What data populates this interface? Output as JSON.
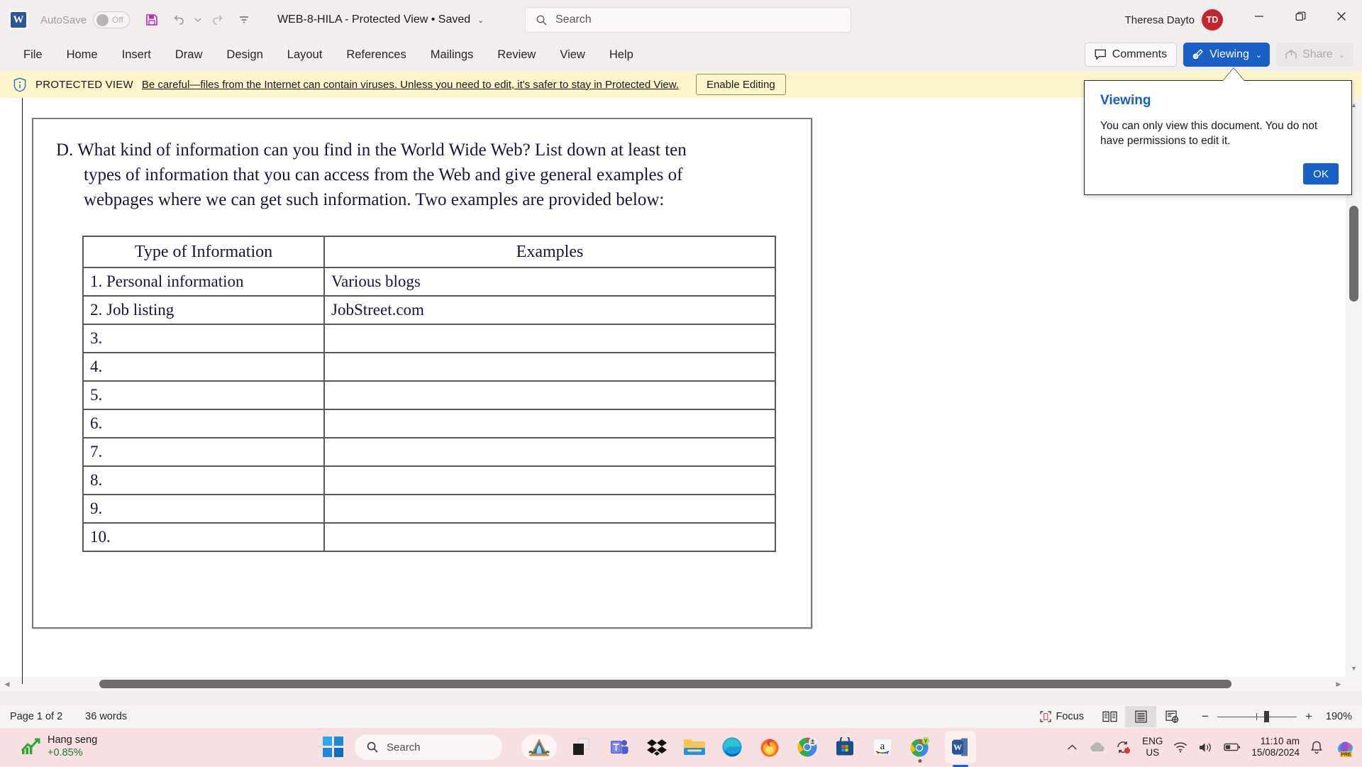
{
  "titlebar": {
    "app_logo": "word-logo",
    "autosave_label": "AutoSave",
    "autosave_state": "Off",
    "save_icon": "save-icon",
    "undo_icon": "undo-icon",
    "redo_icon": "redo-icon",
    "customize_icon": "customize-quick-access-icon",
    "document_title": "WEB-8-HILA  -  Protected View • Saved",
    "title_chevron": "⌄",
    "search_placeholder": "Search",
    "search_icon": "search-icon",
    "user_name": "Theresa Dayto",
    "user_initials": "TD",
    "minimize": "minimize-icon",
    "restore": "restore-icon",
    "close": "close-icon"
  },
  "ribbon": {
    "tabs": [
      {
        "label": "File"
      },
      {
        "label": "Home"
      },
      {
        "label": "Insert"
      },
      {
        "label": "Draw"
      },
      {
        "label": "Design"
      },
      {
        "label": "Layout"
      },
      {
        "label": "References"
      },
      {
        "label": "Mailings"
      },
      {
        "label": "Review"
      },
      {
        "label": "View"
      },
      {
        "label": "Help"
      }
    ],
    "comments_label": "Comments",
    "comments_icon": "comment-icon",
    "viewing_label": "Viewing",
    "viewing_icon": "pen-disabled-icon",
    "viewing_chevron": "⌄",
    "share_label": "Share",
    "share_icon": "share-icon",
    "share_chevron": "⌄",
    "accent_color": "#1a5fc4"
  },
  "protected_view": {
    "icon": "shield-info-icon",
    "label": "PROTECTED VIEW",
    "message": "Be careful—files from the Internet can contain viruses. Unless you need to edit, it's safer to stay in Protected View.",
    "button_label": "Enable Editing",
    "background_color": "#fdf6cd"
  },
  "callout": {
    "title": "Viewing",
    "body": "You can only view this document. You do not have permissions to edit it.",
    "ok_label": "OK",
    "title_color": "#1a5fc4"
  },
  "document": {
    "paragraph_line1": "D. What kind of information can you find in the World Wide Web? List down at least ten",
    "paragraph_line2": "types of information that you can access from the Web and give general examples of",
    "paragraph_line3": "webpages where we can get such information. Two examples are provided below:",
    "table": {
      "headers": [
        "Type of Information",
        "Examples"
      ],
      "rows": [
        [
          "1. Personal information",
          "Various blogs"
        ],
        [
          "2. Job listing",
          "JobStreet.com"
        ],
        [
          "3.",
          ""
        ],
        [
          "4.",
          ""
        ],
        [
          "5.",
          ""
        ],
        [
          "6.",
          ""
        ],
        [
          "7.",
          ""
        ],
        [
          "8.",
          ""
        ],
        [
          "9.",
          ""
        ],
        [
          "10.",
          ""
        ]
      ]
    }
  },
  "statusbar": {
    "page_label": "Page 1 of 2",
    "word_count": "36 words",
    "focus_label": "Focus",
    "focus_icon": "focus-icon",
    "read_mode_icon": "read-mode-icon",
    "print_layout_icon": "print-layout-icon",
    "web_layout_icon": "web-layout-icon",
    "zoom_out": "−",
    "zoom_in": "+",
    "zoom_level": "190%"
  },
  "taskbar": {
    "widget_title": "Hang seng",
    "widget_value": "+0.85%",
    "widget_icon": "stocks-up-icon",
    "start_icon": "windows-start-icon",
    "search_placeholder": "Search",
    "search_icon": "search-icon",
    "apps": [
      {
        "name": "camping-wallpaper-icon"
      },
      {
        "name": "files-dark-icon"
      },
      {
        "name": "microsoft-teams-icon"
      },
      {
        "name": "dropbox-icon"
      },
      {
        "name": "file-explorer-icon"
      },
      {
        "name": "microsoft-edge-icon"
      },
      {
        "name": "firefox-icon"
      },
      {
        "name": "chrome-profile-icon"
      },
      {
        "name": "microsoft-store-icon"
      },
      {
        "name": "amazon-icon"
      },
      {
        "name": "chrome-icon"
      },
      {
        "name": "microsoft-word-icon"
      }
    ],
    "tray": {
      "overflow_icon": "chevron-up-icon",
      "onedrive_icon": "onedrive-icon",
      "sync-alert_icon": "sync-alert-icon",
      "language_line1": "ENG",
      "language_line2": "US",
      "wifi_icon": "wifi-icon",
      "volume_icon": "volume-icon",
      "battery_icon": "battery-icon",
      "time": "11:10 am",
      "date": "15/08/2024",
      "notification_icon": "bell-icon",
      "copilot_icon": "copilot-pre-icon"
    }
  }
}
